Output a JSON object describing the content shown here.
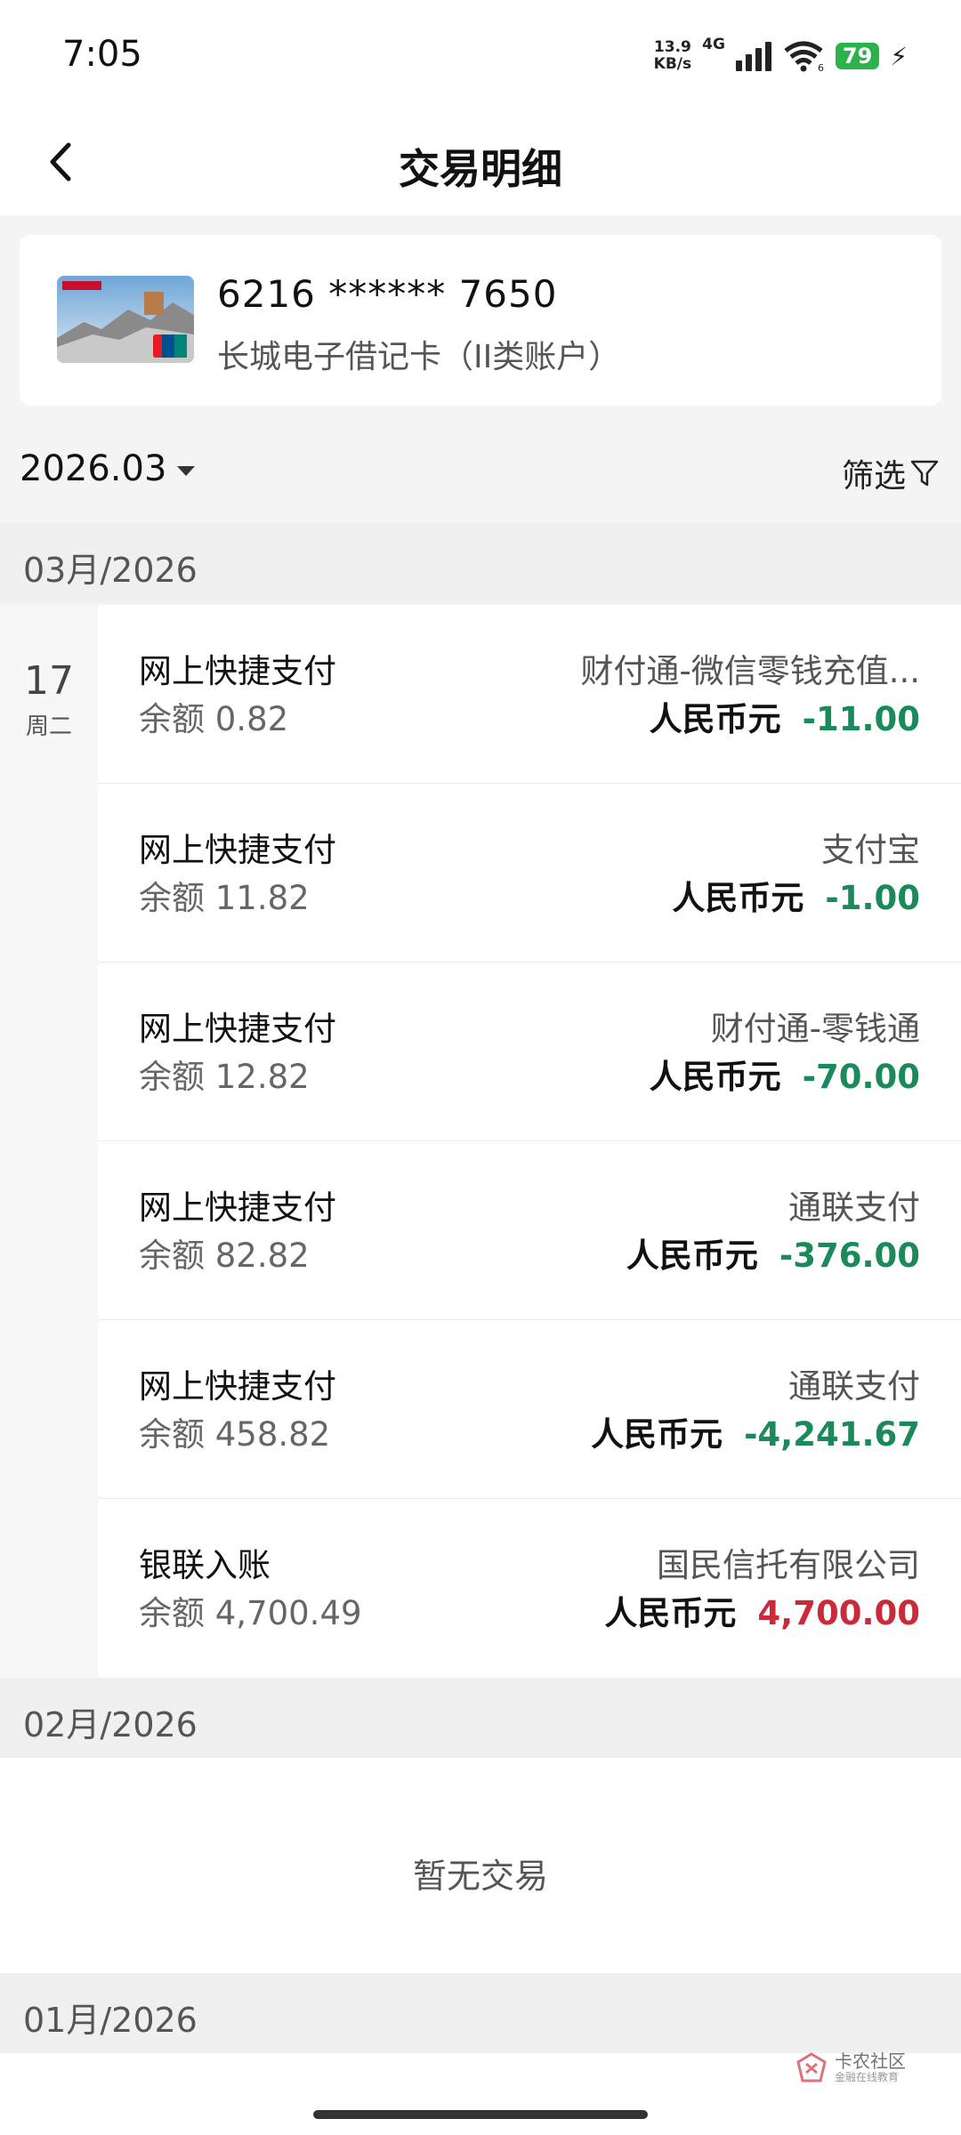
{
  "status_bar": {
    "time": "7:05",
    "net_speed_value": "13.9",
    "net_speed_unit": "KB/s",
    "network": "4G",
    "wifi_index": "6",
    "battery": "79"
  },
  "header": {
    "title": "交易明细"
  },
  "card": {
    "number": "6216 ****** 7650",
    "name": "长城电子借记卡（II类账户）"
  },
  "filter": {
    "month": "2026.03",
    "filter_label": "筛选"
  },
  "months": [
    {
      "label": "03月/2026",
      "day": "17",
      "weekday": "周二",
      "transactions": [
        {
          "type": "网上快捷支付",
          "balance": "余额 0.82",
          "payee": "财付通-微信零钱充值...",
          "currency": "人民币元",
          "amount": "-11.00",
          "color": "#1a8a5a"
        },
        {
          "type": "网上快捷支付",
          "balance": "余额 11.82",
          "payee": "支付宝",
          "currency": "人民币元",
          "amount": "-1.00",
          "color": "#1a8a5a"
        },
        {
          "type": "网上快捷支付",
          "balance": "余额 12.82",
          "payee": "财付通-零钱通",
          "currency": "人民币元",
          "amount": "-70.00",
          "color": "#1a8a5a"
        },
        {
          "type": "网上快捷支付",
          "balance": "余额 82.82",
          "payee": "通联支付",
          "currency": "人民币元",
          "amount": "-376.00",
          "color": "#1a8a5a"
        },
        {
          "type": "网上快捷支付",
          "balance": "余额 458.82",
          "payee": "通联支付",
          "currency": "人民币元",
          "amount": "-4,241.67",
          "color": "#1a8a5a"
        },
        {
          "type": "银联入账",
          "balance": "余额 4,700.49",
          "payee": "国民信托有限公司",
          "currency": "人民币元",
          "amount": "4,700.00",
          "color": "#cc2a3a"
        }
      ]
    },
    {
      "label": "02月/2026",
      "empty_text": "暂无交易"
    },
    {
      "label": "01月/2026"
    }
  ],
  "watermark": {
    "title": "卡农社区",
    "subtitle": "金融在线教育"
  },
  "colors": {
    "expense": "#1a8a5a",
    "income": "#cc2a3a",
    "battery": "#2ab34a"
  }
}
